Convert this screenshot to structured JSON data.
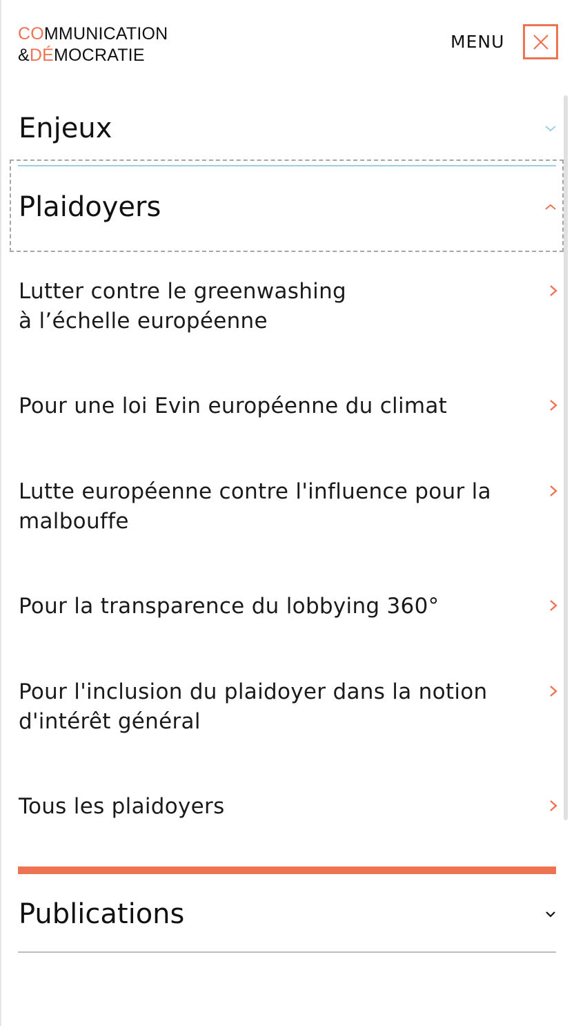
{
  "logo": {
    "line1_accent": "CO",
    "line1_rest": "MMUNICATION",
    "line2_start": "&",
    "line2_accent": "DÉ",
    "line2_rest": "MOCRATIE"
  },
  "header": {
    "menu_label": "MENU"
  },
  "colors": {
    "accent": "#ee7352",
    "enjeux_line": "#9ccfe6"
  },
  "sections": {
    "enjeux": "Enjeux",
    "plaidoyers": "Plaidoyers",
    "publications": "Publications"
  },
  "plaidoyers_items": [
    {
      "text": "Lutter contre le greenwashing\nà l’échelle européenne"
    },
    {
      "text": "Pour une loi Evin européenne du climat"
    },
    {
      "text": "Lutte européenne contre l'influence pour la malbouffe"
    },
    {
      "text": "Pour la transparence du lobbying 360°"
    },
    {
      "text": "Pour l'inclusion du plaidoyer dans la notion d'intérêt général"
    },
    {
      "text": "Tous les plaidoyers"
    }
  ],
  "icons": {
    "close": "close-icon",
    "enjeux": "chevron-down-icon",
    "plaidoyers": "chevron-up-icon",
    "items": "chevron-right-icon",
    "publications": "chevron-down-icon"
  }
}
